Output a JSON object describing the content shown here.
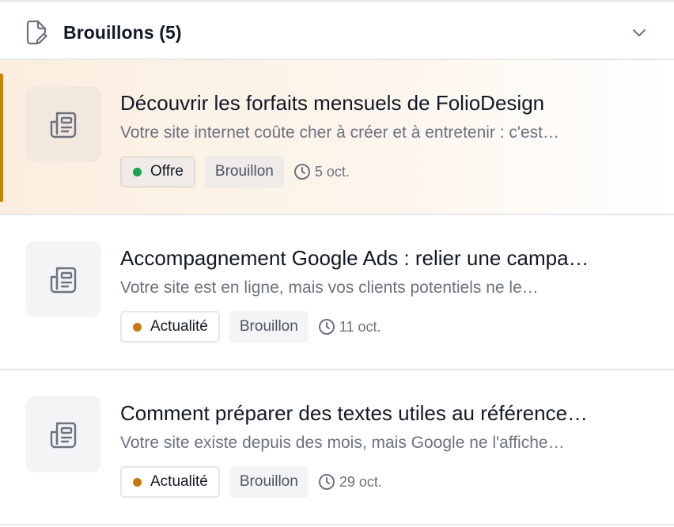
{
  "header": {
    "title": "Brouillons (5)",
    "icon": "document-edit-icon",
    "toggle_icon": "chevron-down-icon"
  },
  "items": [
    {
      "title": "Découvrir les forfaits mensuels de FolioDesign",
      "excerpt": "Votre site internet coûte cher à créer et à entretenir : c'est…",
      "category": "Offre",
      "category_color": "#16a34a",
      "status": "Brouillon",
      "date": "5 oct.",
      "thumbnail_icon": "newspaper-icon",
      "selected": true
    },
    {
      "title": "Accompagnement Google Ads : relier une campa…",
      "excerpt": "Votre site est en ligne, mais vos clients potentiels ne le…",
      "category": "Actualité",
      "category_color": "#c8780e",
      "status": "Brouillon",
      "date": "11 oct.",
      "thumbnail_icon": "newspaper-icon",
      "selected": false
    },
    {
      "title": "Comment préparer des textes utiles au référence…",
      "excerpt": "Votre site existe depuis des mois, mais Google ne l'affiche…",
      "category": "Actualité",
      "category_color": "#c8780e",
      "status": "Brouillon",
      "date": "29 oct.",
      "thumbnail_icon": "newspaper-icon",
      "selected": false
    }
  ],
  "colors": {
    "accent": "#c8830a",
    "border": "#e5e7eb",
    "muted_text": "#6b7280"
  }
}
